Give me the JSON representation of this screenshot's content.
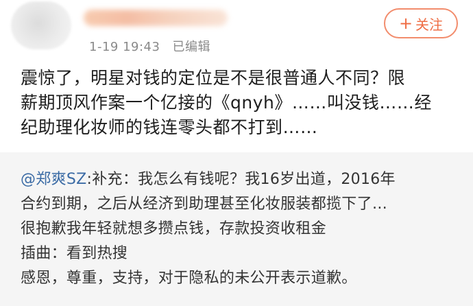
{
  "post": {
    "timestamp": "1-19 19:43",
    "edited_label": "已编辑",
    "follow_label": "关注",
    "follow_icon": "plus-icon",
    "content_lines": [
      "震惊了，明星对钱的定位是不是很普通人不同？限",
      "薪期顶风作案一个亿接的《qnyh》……叫没钱……经",
      "纪助理化妆师的钱连零头都不打到……"
    ]
  },
  "repost": {
    "mention": "@郑爽SZ",
    "line1_rest": ":补充：我怎么有钱呢？我16岁出道，2016年",
    "lines": [
      "合约到期，之后从经济到助理甚至化妆服装都揽下了…",
      "很抱歉我年轻就想多攒点钱，存款投资收租金",
      "插曲：看到热搜",
      "感恩，尊重，支持，对于隐私的未公开表示道歉。"
    ]
  }
}
